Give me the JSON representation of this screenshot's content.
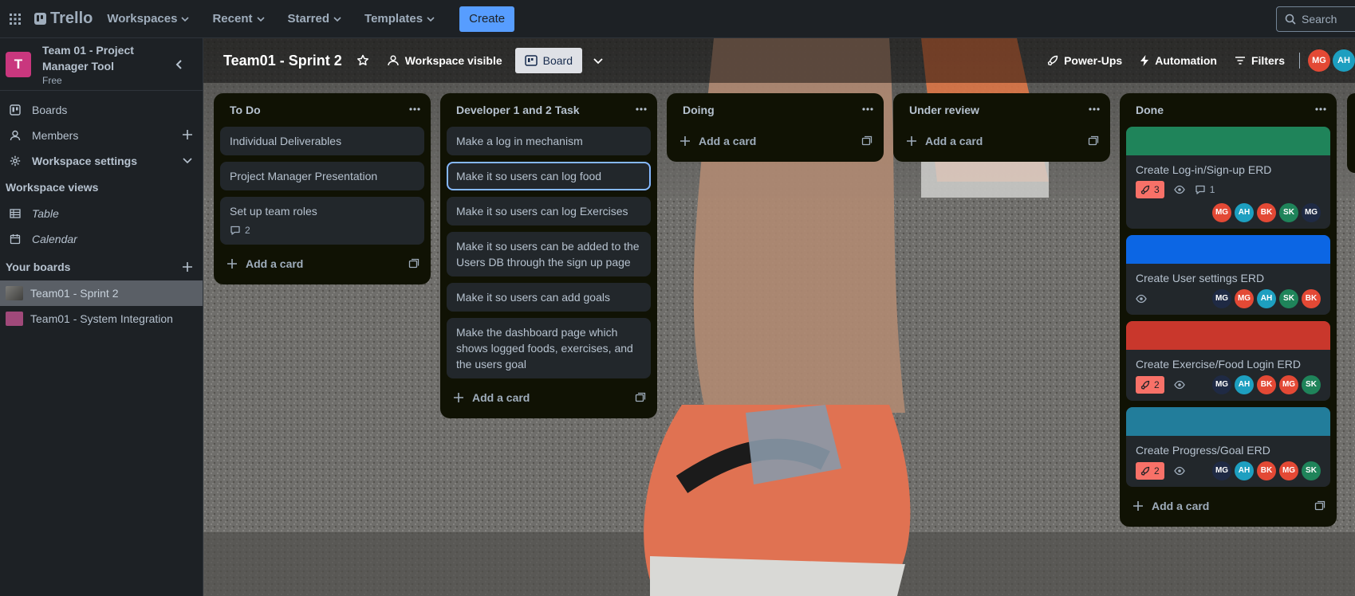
{
  "topbar": {
    "app_name": "Trello",
    "menus": [
      "Workspaces",
      "Recent",
      "Starred",
      "Templates"
    ],
    "create_label": "Create",
    "search_placeholder": "Search"
  },
  "sidebar": {
    "workspace_initial": "T",
    "workspace_name": "Team 01 - Project Manager Tool",
    "workspace_plan": "Free",
    "items": [
      {
        "label": "Boards",
        "icon": "boards-icon"
      },
      {
        "label": "Members",
        "icon": "members-icon"
      },
      {
        "label": "Workspace settings",
        "icon": "gear-icon"
      }
    ],
    "views_title": "Workspace views",
    "views": [
      {
        "label": "Table",
        "icon": "table-icon"
      },
      {
        "label": "Calendar",
        "icon": "calendar-icon"
      }
    ],
    "your_boards_title": "Your boards",
    "boards": [
      {
        "label": "Team01 - Sprint 2",
        "color": "#4a4a4a"
      },
      {
        "label": "Team01 - System Integration",
        "color": "#a0497a"
      }
    ]
  },
  "board": {
    "name": "Team01 - Sprint 2",
    "visibility_label": "Workspace visible",
    "view_label": "Board",
    "powerups_label": "Power-Ups",
    "automation_label": "Automation",
    "filters_label": "Filters",
    "header_members": [
      {
        "initials": "MG",
        "color": "#e34935"
      },
      {
        "initials": "AH",
        "color": "#1d9fc0"
      }
    ]
  },
  "add_card_label": "Add a card",
  "colors": {
    "mg": "#e34935",
    "ah": "#1d9fc0",
    "bk": "#e34935",
    "sk": "#1f845a",
    "mg_dark": "#1f2a44"
  },
  "lists": [
    {
      "title": "To Do",
      "cards": [
        {
          "title": "Individual Deliverables"
        },
        {
          "title": "Project Manager Presentation"
        },
        {
          "title": "Set up team roles",
          "comments": "2"
        }
      ]
    },
    {
      "title": "Developer 1 and 2 Task",
      "cards": [
        {
          "title": "Make a log in mechanism"
        },
        {
          "title": "Make it so users can log food",
          "focused": true
        },
        {
          "title": "Make it so users can log Exercises"
        },
        {
          "title": "Make it so users can be added to the Users DB through the sign up page"
        },
        {
          "title": "Make it so users can add goals"
        },
        {
          "title": "Make the dashboard page which shows logged foods, exercises, and the users goal"
        }
      ]
    },
    {
      "title": "Doing",
      "cards": []
    },
    {
      "title": "Under review",
      "cards": []
    },
    {
      "title": "Done",
      "cards": [
        {
          "title": "Create Log-in/Sign-up ERD",
          "cover": "#1f845a",
          "likes": "3",
          "watch": true,
          "comments": "1",
          "members": [
            {
              "i": "MG",
              "c": "#e34935"
            },
            {
              "i": "AH",
              "c": "#1d9fc0"
            },
            {
              "i": "BK",
              "c": "#e34935"
            },
            {
              "i": "SK",
              "c": "#1f845a"
            },
            {
              "i": "MG",
              "c": "#1f2a44"
            }
          ]
        },
        {
          "title": "Create User settings ERD",
          "cover": "#0c66e4",
          "watch": true,
          "members": [
            {
              "i": "MG",
              "c": "#1f2a44"
            },
            {
              "i": "MG",
              "c": "#e34935"
            },
            {
              "i": "AH",
              "c": "#1d9fc0"
            },
            {
              "i": "SK",
              "c": "#1f845a"
            },
            {
              "i": "BK",
              "c": "#e34935"
            }
          ]
        },
        {
          "title": "Create Exercise/Food Login ERD",
          "cover": "#c9372c",
          "likes": "2",
          "watch": true,
          "members": [
            {
              "i": "MG",
              "c": "#1f2a44"
            },
            {
              "i": "AH",
              "c": "#1d9fc0"
            },
            {
              "i": "BK",
              "c": "#e34935"
            },
            {
              "i": "MG",
              "c": "#e34935"
            },
            {
              "i": "SK",
              "c": "#1f845a"
            }
          ]
        },
        {
          "title": "Create Progress/Goal ERD",
          "cover": "#227d9b",
          "likes": "2",
          "watch": true,
          "members": [
            {
              "i": "MG",
              "c": "#1f2a44"
            },
            {
              "i": "AH",
              "c": "#1d9fc0"
            },
            {
              "i": "BK",
              "c": "#e34935"
            },
            {
              "i": "MG",
              "c": "#e34935"
            },
            {
              "i": "SK",
              "c": "#1f845a"
            }
          ]
        }
      ]
    }
  ]
}
